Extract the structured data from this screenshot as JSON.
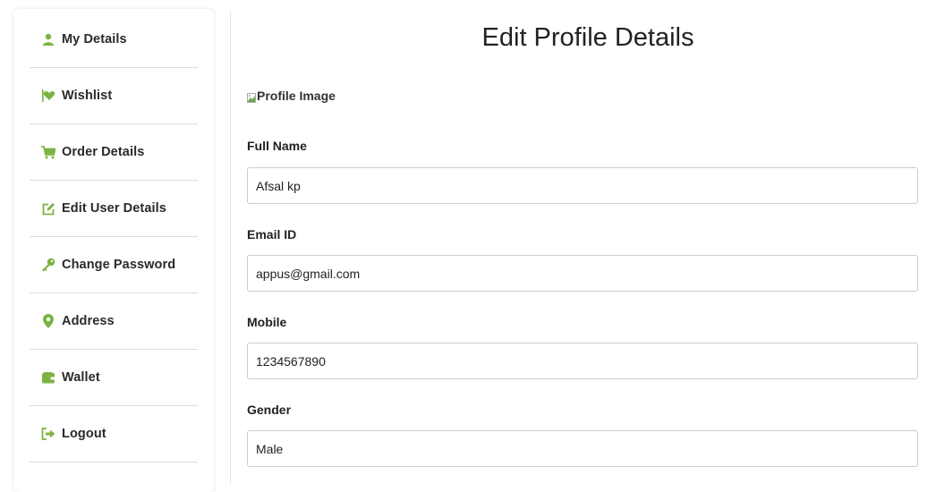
{
  "sidebar": {
    "items": [
      {
        "label": "My Details",
        "icon": "user-icon"
      },
      {
        "label": "Wishlist",
        "icon": "heart-flag-icon"
      },
      {
        "label": "Order Details",
        "icon": "cart-icon"
      },
      {
        "label": "Edit User Details",
        "icon": "edit-icon"
      },
      {
        "label": "Change Password",
        "icon": "key-icon"
      },
      {
        "label": "Address",
        "icon": "map-pin-icon"
      },
      {
        "label": "Wallet",
        "icon": "wallet-icon"
      },
      {
        "label": "Logout",
        "icon": "logout-icon"
      }
    ]
  },
  "main": {
    "title": "Edit Profile Details",
    "profile_image_alt": "Profile Image",
    "fields": {
      "full_name": {
        "label": "Full Name",
        "value": "Afsal kp"
      },
      "email": {
        "label": "Email ID",
        "value": "appus@gmail.com"
      },
      "mobile": {
        "label": "Mobile",
        "value": "1234567890"
      },
      "gender": {
        "label": "Gender",
        "value": "Male"
      }
    }
  },
  "colors": {
    "accent": "#7cb342",
    "border": "#cccccc",
    "divider": "#dcdcdc"
  }
}
